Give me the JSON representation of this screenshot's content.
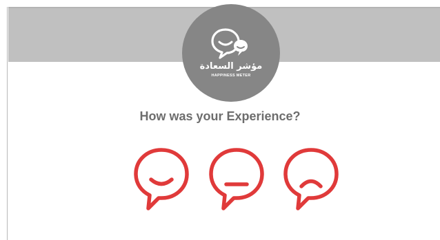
{
  "logo": {
    "arabic_text": "مؤشر السعادة",
    "english_text": "HAPPINESS METER",
    "icon": "chat-bubbles-icon",
    "background_color": "#868686"
  },
  "question": {
    "text": "How was your Experience?",
    "color": "#6d6d6d"
  },
  "faces": [
    {
      "name": "happy",
      "icon": "happy-face-icon",
      "color": "#e03a3a"
    },
    {
      "name": "neutral",
      "icon": "neutral-face-icon",
      "color": "#e03a3a"
    },
    {
      "name": "sad",
      "icon": "sad-face-icon",
      "color": "#e03a3a"
    }
  ],
  "colors": {
    "header_band": "#c0c0c0",
    "accent_red": "#e03a3a"
  }
}
